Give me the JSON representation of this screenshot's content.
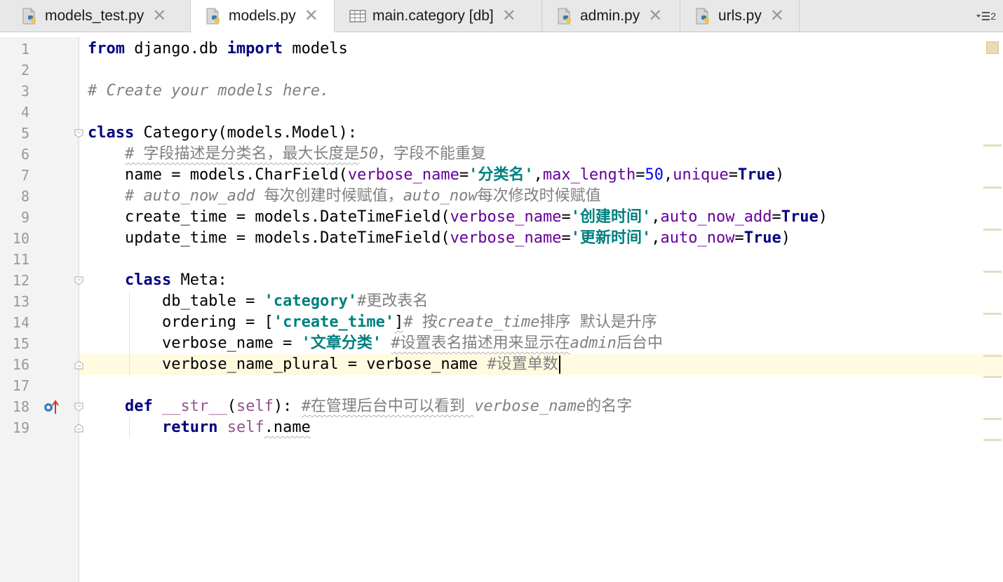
{
  "tabs": [
    {
      "label": "models_test.py",
      "icon": "python-file-icon",
      "active": false
    },
    {
      "label": "models.py",
      "icon": "python-file-icon",
      "active": true
    },
    {
      "label": "main.category [db]",
      "icon": "db-table-icon",
      "active": false
    },
    {
      "label": "admin.py",
      "icon": "python-file-icon",
      "active": false
    },
    {
      "label": "urls.py",
      "icon": "python-file-icon",
      "active": false
    }
  ],
  "tab_close_glyph": "✕",
  "overflow": {
    "count": "2"
  },
  "editor": {
    "current_line": 16,
    "lines": [
      [
        {
          "t": "from",
          "c": "kw"
        },
        {
          "t": " django.db "
        },
        {
          "t": "import",
          "c": "kw"
        },
        {
          "t": " models"
        }
      ],
      [],
      [
        {
          "t": "# Create your models here.",
          "c": "cm"
        }
      ],
      [],
      [
        {
          "t": "class",
          "c": "kw"
        },
        {
          "t": " Category(models.Model):"
        }
      ],
      [
        {
          "t": "    "
        },
        {
          "t": "# 字段描述是分类名，最大长度是",
          "c": "cmc"
        },
        {
          "t": "50",
          "c": "cm"
        },
        {
          "t": "，字段不能重复",
          "c": "cmc"
        }
      ],
      [
        {
          "t": "    name = models.CharField("
        },
        {
          "t": "verbose_name",
          "c": "pm"
        },
        {
          "t": "="
        },
        {
          "t": "'分类名'",
          "c": "st"
        },
        {
          "t": ","
        },
        {
          "t": "max_length",
          "c": "pm"
        },
        {
          "t": "="
        },
        {
          "t": "50",
          "c": "nm"
        },
        {
          "t": ","
        },
        {
          "t": "unique",
          "c": "pm"
        },
        {
          "t": "="
        },
        {
          "t": "True",
          "c": "kw"
        },
        {
          "t": ")"
        }
      ],
      [
        {
          "t": "    "
        },
        {
          "t": "# auto_now_add ",
          "c": "cm"
        },
        {
          "t": "每次创建时候赋值，",
          "c": "cmc"
        },
        {
          "t": "auto_now",
          "c": "cm"
        },
        {
          "t": "每次修改时候赋值",
          "c": "cmc"
        }
      ],
      [
        {
          "t": "    create_time = models.DateTimeField("
        },
        {
          "t": "verbose_name",
          "c": "pm"
        },
        {
          "t": "="
        },
        {
          "t": "'创建时间'",
          "c": "st"
        },
        {
          "t": ","
        },
        {
          "t": "auto_now_add",
          "c": "pm"
        },
        {
          "t": "="
        },
        {
          "t": "True",
          "c": "kw"
        },
        {
          "t": ")"
        }
      ],
      [
        {
          "t": "    update_time = models.DateTimeField("
        },
        {
          "t": "verbose_name",
          "c": "pm"
        },
        {
          "t": "="
        },
        {
          "t": "'更新时间'",
          "c": "st"
        },
        {
          "t": ","
        },
        {
          "t": "auto_now",
          "c": "pm"
        },
        {
          "t": "="
        },
        {
          "t": "True",
          "c": "kw"
        },
        {
          "t": ")"
        }
      ],
      [],
      [
        {
          "t": "    "
        },
        {
          "t": "class",
          "c": "kw"
        },
        {
          "t": " Meta:"
        }
      ],
      [
        {
          "t": "        db_table = "
        },
        {
          "t": "'category'",
          "c": "st"
        },
        {
          "t": "#更改表名",
          "c": "cmc"
        }
      ],
      [
        {
          "t": "        ordering = ["
        },
        {
          "t": "'create_time'",
          "c": "st"
        },
        {
          "t": "]"
        },
        {
          "t": "# 按",
          "c": "cmc"
        },
        {
          "t": "create_time",
          "c": "cm"
        },
        {
          "t": "排序 默认是升序",
          "c": "cmc"
        }
      ],
      [
        {
          "t": "        verbose_name = "
        },
        {
          "t": "'文章分类'",
          "c": "st"
        },
        {
          "t": " "
        },
        {
          "t": "#设置表名描述用来显示在",
          "c": "cmc"
        },
        {
          "t": "admin",
          "c": "cm"
        },
        {
          "t": "后台中",
          "c": "cmc"
        }
      ],
      [
        {
          "t": "        verbose_name_plural = verbose_name "
        },
        {
          "t": "#设置单数",
          "c": "cmc"
        }
      ],
      [],
      [
        {
          "t": "    "
        },
        {
          "t": "def",
          "c": "kw"
        },
        {
          "t": " "
        },
        {
          "t": "__str__",
          "c": "sf"
        },
        {
          "t": "("
        },
        {
          "t": "self",
          "c": "sf"
        },
        {
          "t": "): "
        },
        {
          "t": "#在管理后台中可以看到 ",
          "c": "cmc"
        },
        {
          "t": "verbose_name",
          "c": "cm"
        },
        {
          "t": "的名字",
          "c": "cmc"
        }
      ],
      [
        {
          "t": "        "
        },
        {
          "t": "return",
          "c": "kw"
        },
        {
          "t": " "
        },
        {
          "t": "self",
          "c": "sf"
        },
        {
          "t": ".name"
        }
      ]
    ]
  },
  "gutter_icons": [
    {
      "line": 18,
      "icon": "override-up-arrow-icon"
    }
  ],
  "colors": {
    "keyword": "#000080",
    "comment": "#808080",
    "string": "#008080",
    "param": "#660099",
    "number": "#0000ff",
    "self": "#94558d",
    "current_line": "#fffae0"
  }
}
